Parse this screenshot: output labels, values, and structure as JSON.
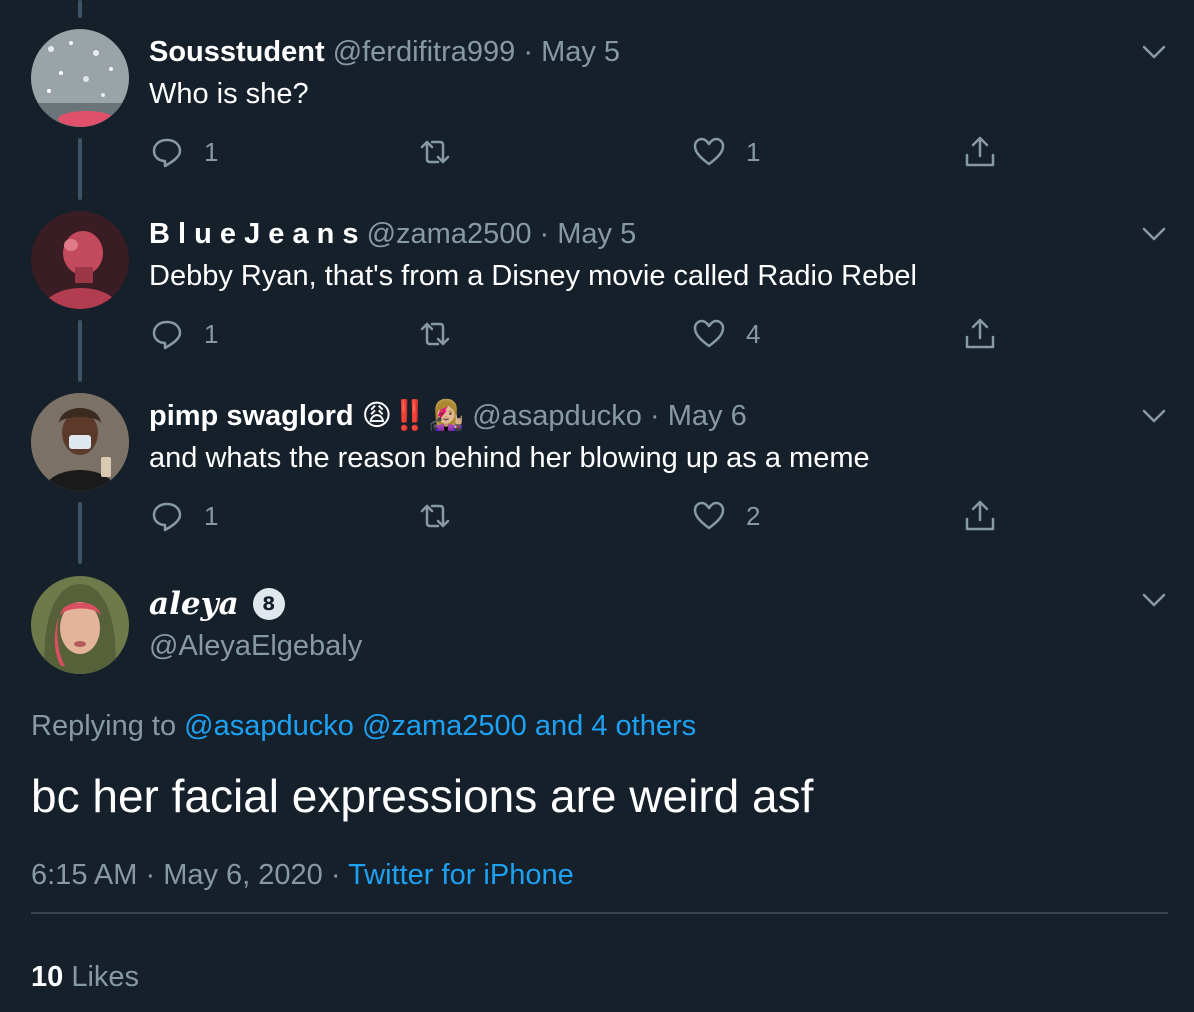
{
  "replies": [
    {
      "name": "Sousstudent",
      "handle": "@ferdifitra999",
      "separator": "·",
      "date": "May 5",
      "text": "Who is she?",
      "reply_count": "1",
      "retweet_count": "",
      "like_count": "1",
      "avatar_icon": "avatar-image"
    },
    {
      "name": "B l u e J e a n s",
      "handle": "@zama2500",
      "separator": "·",
      "date": "May 5",
      "text": "Debby Ryan, that's from a Disney movie called Radio Rebel",
      "reply_count": "1",
      "retweet_count": "",
      "like_count": "4",
      "avatar_icon": "avatar-image"
    },
    {
      "name": "pimp swaglord",
      "name_emojis": "😩‼️👩🏼‍🎤",
      "handle": "@asapducko",
      "separator": "·",
      "date": "May 6",
      "text": "and whats the reason behind her blowing up as a meme",
      "reply_count": "1",
      "retweet_count": "",
      "like_count": "2",
      "avatar_icon": "avatar-image"
    }
  ],
  "main": {
    "name": "aleya",
    "badge": "8",
    "handle": "@AleyaElgebaly",
    "replying_prefix": "Replying to",
    "replying_to": [
      "@asapducko",
      "@zama2500"
    ],
    "replying_and": "and 4 others",
    "text": "bc her facial expressions are weird asf",
    "time": "6:15 AM",
    "date": "May 6, 2020",
    "source": "Twitter for iPhone",
    "likes_count": "10",
    "likes_label": "Likes"
  },
  "colors": {
    "background": "#15202b",
    "secondary_text": "#8899a6",
    "link": "#1da1f2",
    "thread_line": "#3d5466",
    "divider": "#38444d"
  },
  "icons": [
    "reply-icon",
    "retweet-icon",
    "like-icon",
    "share-icon",
    "chevron-down-icon"
  ]
}
